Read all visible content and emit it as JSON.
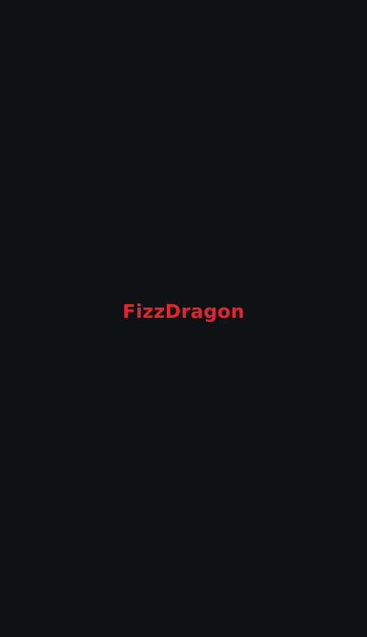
{
  "app": {
    "brand_name": "FizzDragon",
    "brand_color": "#e0262d",
    "background_color": "#0f1115"
  }
}
